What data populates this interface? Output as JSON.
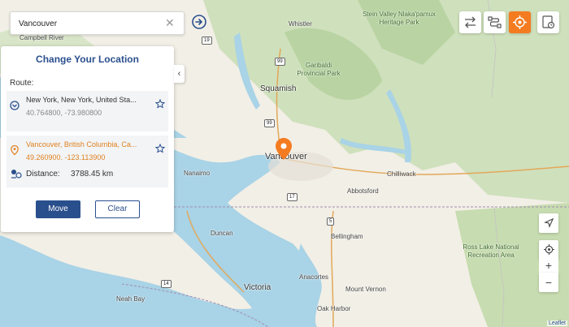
{
  "search": {
    "value": "Vancouver",
    "placeholder": ""
  },
  "panel": {
    "title": "Change Your Location",
    "route_label": "Route:",
    "start": {
      "name": "New York, New York, United Sta...",
      "coords": "40.764800, -73.980800"
    },
    "end": {
      "name": "Vancouver, British Columbia, Ca...",
      "coords": "49.260900, -123.113900"
    },
    "distance_label": "Distance:",
    "distance_value": "3788.45 km",
    "move_label": "Move",
    "clear_label": "Clear"
  },
  "map": {
    "labels": {
      "campbell_river": "Campbell River",
      "whistler": "Whistler",
      "stein_valley": "Stein Valley Nlaka'pamux Heritage Park",
      "garibaldi": "Garibaldi Provincial Park",
      "squamish": "Squamish",
      "vancouver": "Vancouver",
      "nanaimo": "Nanaimo",
      "chilliwack": "Chilliwack",
      "abbotsford": "Abbotsford",
      "duncan": "Duncan",
      "bellingham": "Bellingham",
      "ross_lake": "Ross Lake National Recreation Area",
      "victoria": "Victoria",
      "neah_bay": "Neah Bay",
      "anacortes": "Anacortes",
      "mount_vernon": "Mount Vernon",
      "oak_harbor": "Oak Harbor"
    },
    "shields": {
      "s19": "19",
      "s99a": "99",
      "s99b": "99",
      "s17": "17",
      "s14": "14",
      "s5": "5"
    },
    "attribution": "Leaflet"
  },
  "colors": {
    "accent": "#f47b20",
    "primary": "#2a4f8d",
    "water": "#a9d3e6",
    "land": "#f2efe6",
    "forest": "#c9dcb4"
  },
  "icons": {
    "search_go": "arrow-right-circle-icon",
    "clear": "close-icon",
    "toolbar": [
      "swap-icon",
      "route-icon",
      "target-icon",
      "history-icon"
    ]
  }
}
